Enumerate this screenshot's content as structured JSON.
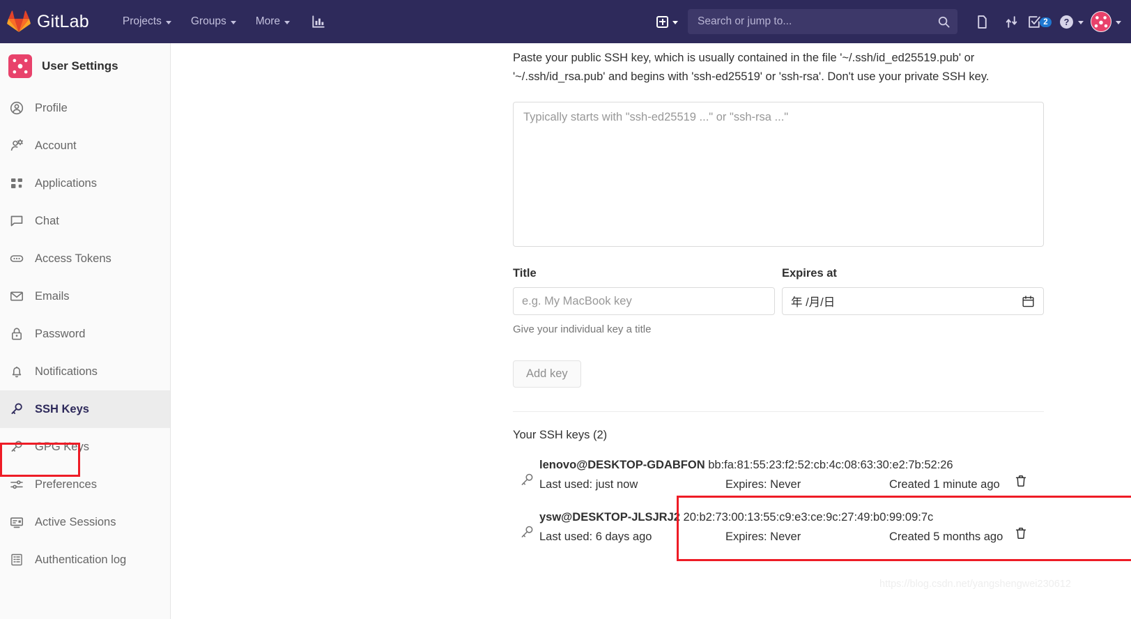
{
  "navbar": {
    "brand": "GitLab",
    "links": [
      {
        "label": "Projects"
      },
      {
        "label": "Groups"
      },
      {
        "label": "More"
      }
    ],
    "analytics_icon": "chart-bar-icon",
    "new_icon": "plus-square-icon",
    "search": {
      "placeholder": "Search or jump to...",
      "value": ""
    },
    "icons": [
      {
        "name": "issues-icon"
      },
      {
        "name": "merge-requests-icon"
      },
      {
        "name": "todos-icon",
        "badge": "2"
      },
      {
        "name": "help-icon"
      }
    ],
    "avatar_label": "user-avatar"
  },
  "sidebar": {
    "title": "User Settings",
    "items": [
      {
        "label": "Profile",
        "icon": "user-circle-icon",
        "active": false
      },
      {
        "label": "Account",
        "icon": "user-gear-icon",
        "active": false
      },
      {
        "label": "Applications",
        "icon": "grid-icon",
        "active": false
      },
      {
        "label": "Chat",
        "icon": "comment-icon",
        "active": false
      },
      {
        "label": "Access Tokens",
        "icon": "token-icon",
        "active": false
      },
      {
        "label": "Emails",
        "icon": "envelope-icon",
        "active": false
      },
      {
        "label": "Password",
        "icon": "lock-icon",
        "active": false
      },
      {
        "label": "Notifications",
        "icon": "bell-icon",
        "active": false
      },
      {
        "label": "SSH Keys",
        "icon": "key-icon",
        "active": true
      },
      {
        "label": "GPG Keys",
        "icon": "key-icon",
        "active": false
      },
      {
        "label": "Preferences",
        "icon": "sliders-icon",
        "active": false
      },
      {
        "label": "Active Sessions",
        "icon": "monitor-icon",
        "active": false
      },
      {
        "label": "Authentication log",
        "icon": "list-grid-icon",
        "active": false
      }
    ]
  },
  "main": {
    "hint": "Paste your public SSH key, which is usually contained in the file '~/.ssh/id_ed25519.pub' or '~/.ssh/id_rsa.pub' and begins with 'ssh-ed25519' or 'ssh-rsa'. Don't use your private SSH key.",
    "key_textarea": {
      "placeholder": "Typically starts with \"ssh-ed25519 ...\" or \"ssh-rsa ...\"",
      "value": ""
    },
    "title_field": {
      "label": "Title",
      "placeholder": "e.g. My MacBook key",
      "value": "",
      "help": "Give your individual key a title"
    },
    "expires_field": {
      "label": "Expires at",
      "placeholder": "年 /月/日",
      "value": "",
      "calendar_icon": "calendar-icon"
    },
    "add_key_button": "Add key",
    "keys_heading": "Your SSH keys (2)",
    "keys": [
      {
        "title": "lenovo@DESKTOP-GDABFON",
        "fingerprint": "bb:fa:81:55:23:f2:52:cb:4c:08:63:30:e2:7b:52:26",
        "last_used": "Last used: just now",
        "expires": "Expires: Never",
        "created": "Created 1 minute ago",
        "highlighted": true
      },
      {
        "title": "ysw@DESKTOP-JLSJRJ2",
        "fingerprint": "20:b2:73:00:13:55:c9:e3:ce:9c:27:49:b0:99:09:7c",
        "last_used": "Last used: 6 days ago",
        "expires": "Expires: Never",
        "created": "Created 5 months ago",
        "highlighted": false
      }
    ],
    "watermark": "https://blog.csdn.net/yangshengwei230612"
  },
  "colors": {
    "navbar_bg": "#2e2a5b",
    "accent_red": "#ee1c26",
    "badge_blue": "#1f78d1",
    "avatar_pink": "#e8426b"
  }
}
